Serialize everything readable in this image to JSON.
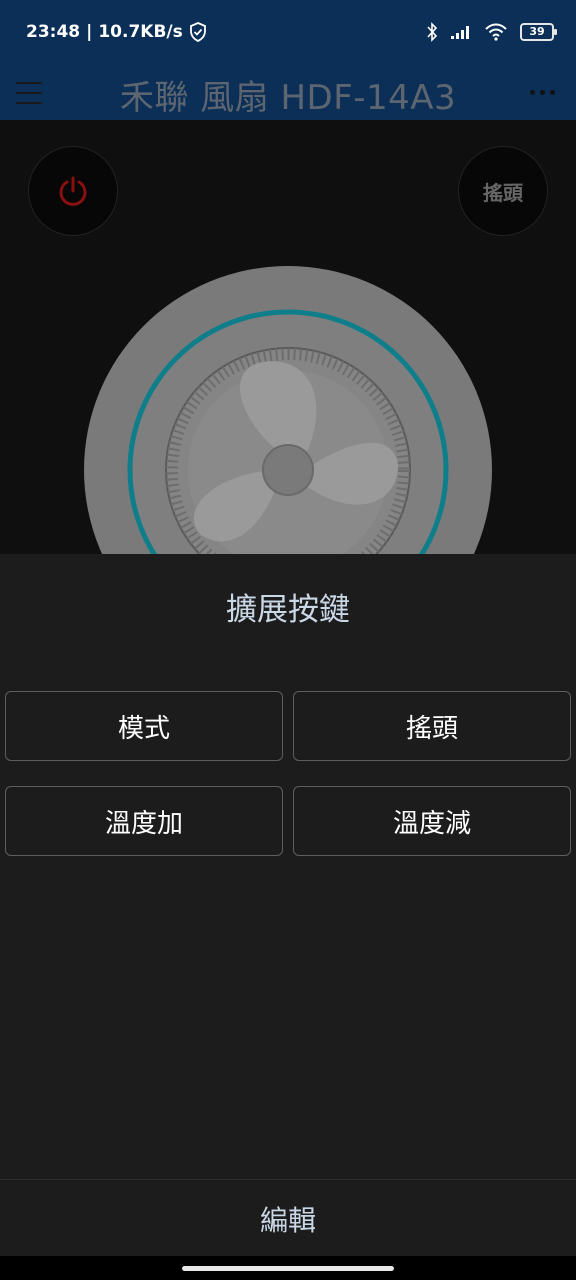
{
  "status_bar": {
    "time": "23:48",
    "speed": "10.7KB/s",
    "battery": "39"
  },
  "header": {
    "title": "禾聯 風扇 HDF-14A3"
  },
  "main": {
    "swing_label": "搖頭"
  },
  "sheet": {
    "title": "擴展按鍵",
    "buttons": [
      "模式",
      "搖頭",
      "溫度加",
      "溫度減"
    ],
    "edit_label": "編輯"
  },
  "colors": {
    "header_bg": "#0b2f57",
    "sheet_bg": "#1c1c1c",
    "ring_teal": "#0e7f8a",
    "power_red": "#8a1010"
  }
}
